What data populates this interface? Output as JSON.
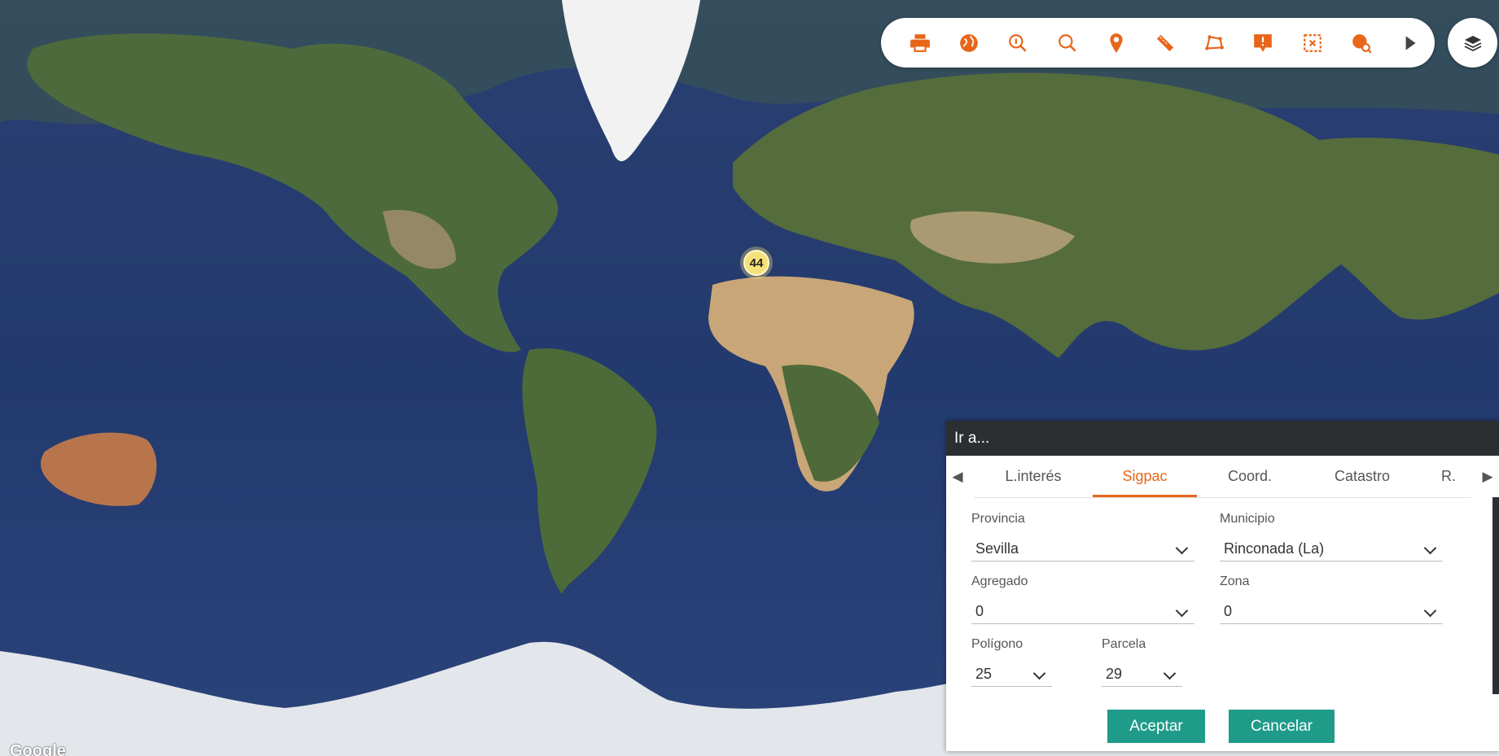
{
  "map": {
    "cluster_count": "44",
    "attribution": "Google"
  },
  "toolbar": {
    "tools": [
      {
        "name": "print-icon"
      },
      {
        "name": "globe-icon"
      },
      {
        "name": "zoom-info-icon"
      },
      {
        "name": "search-icon"
      },
      {
        "name": "location-pin-icon"
      },
      {
        "name": "ruler-icon"
      },
      {
        "name": "polygon-icon"
      },
      {
        "name": "info-marker-icon"
      },
      {
        "name": "select-area-icon"
      },
      {
        "name": "globe-search-icon"
      },
      {
        "name": "expand-arrow-icon"
      }
    ],
    "accent_color": "#e8661a",
    "layers_icon": "layers-icon"
  },
  "dialog": {
    "title": "Ir a...",
    "tabs": [
      {
        "label": "L.interés",
        "active": false
      },
      {
        "label": "Sigpac",
        "active": true
      },
      {
        "label": "Coord.",
        "active": false
      },
      {
        "label": "Catastro",
        "active": false
      },
      {
        "label": "R.",
        "active": false
      }
    ],
    "fields": {
      "provincia": {
        "label": "Provincia",
        "value": "Sevilla"
      },
      "municipio": {
        "label": "Municipio",
        "value": "Rinconada (La)"
      },
      "agregado": {
        "label": "Agregado",
        "value": "0"
      },
      "zona": {
        "label": "Zona",
        "value": "0"
      },
      "poligono": {
        "label": "Polígono",
        "value": "25"
      },
      "parcela": {
        "label": "Parcela",
        "value": "29"
      }
    },
    "accept_label": "Aceptar",
    "cancel_label": "Cancelar",
    "button_color": "#1f9b8a"
  }
}
